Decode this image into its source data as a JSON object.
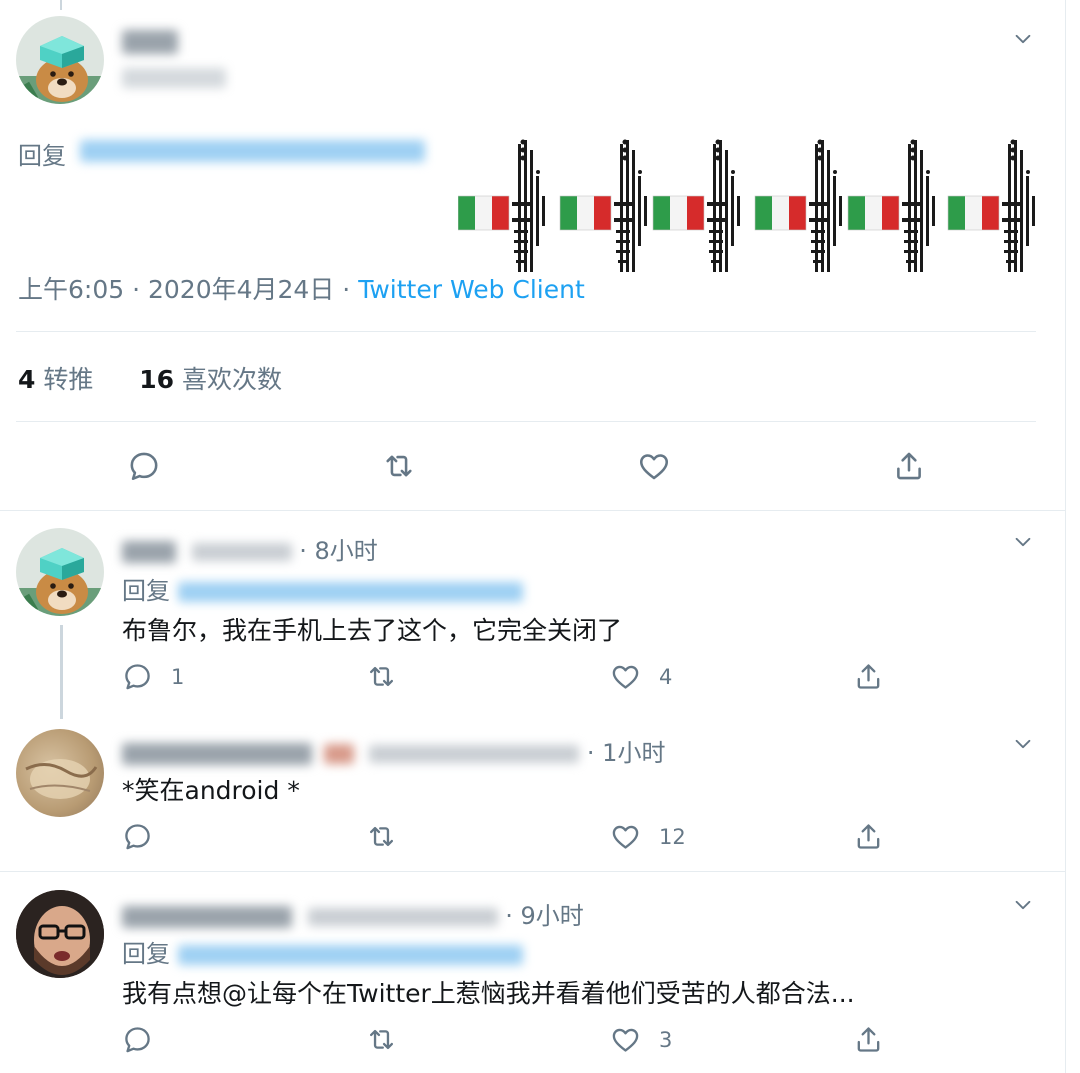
{
  "main_tweet": {
    "reply_prefix": "回复",
    "meta": {
      "time": "上午6:05",
      "separator": "·",
      "date": "2020年4月24日",
      "client": "Twitter Web Client"
    },
    "stats": {
      "retweets_count": "4",
      "retweets_label": "转推",
      "likes_count": "16",
      "likes_label": "喜欢次数"
    }
  },
  "replies": [
    {
      "time": "· 8小时",
      "reply_prefix": "回复",
      "text": "布鲁尔，我在手机上去了这个，它完全关闭了",
      "reply_count": "1",
      "like_count": "4"
    },
    {
      "time": "· 1小时",
      "text": "*笑在android *",
      "reply_count": "",
      "like_count": "12"
    },
    {
      "time": "· 9小时",
      "reply_prefix": "回复",
      "text": "我有点想@让每个在Twitter上惹恼我并看着他们受苦的人都合法...",
      "reply_count": "",
      "like_count": "3"
    }
  ],
  "colors": {
    "accent": "#1da1f2",
    "secondary_text": "#657786",
    "primary_text": "#14171a",
    "border": "#e6ecf0"
  },
  "icons": [
    "chevron-down-icon",
    "reply-icon",
    "retweet-icon",
    "like-icon",
    "share-icon"
  ]
}
